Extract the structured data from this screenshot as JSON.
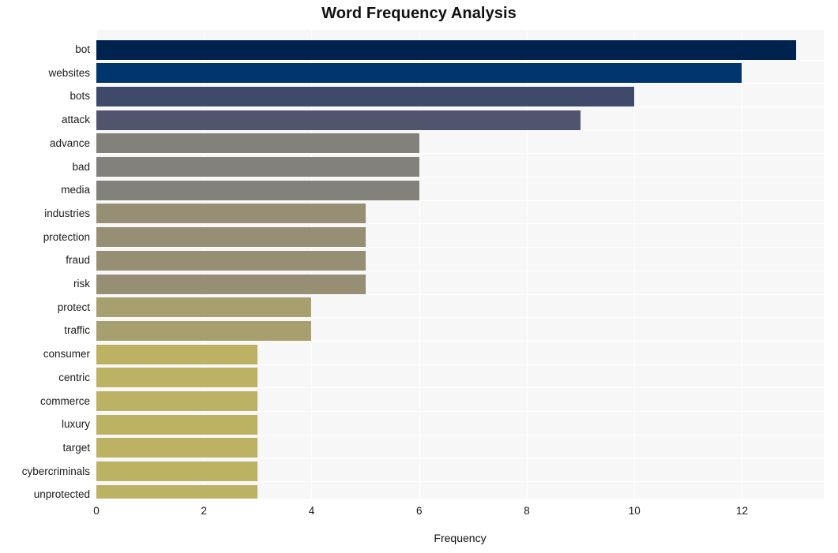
{
  "chart_data": {
    "type": "bar",
    "orientation": "horizontal",
    "title": "Word Frequency Analysis",
    "xlabel": "Frequency",
    "ylabel": "",
    "xlim": [
      0,
      13.52
    ],
    "xticks": [
      0,
      2,
      4,
      6,
      8,
      10,
      12
    ],
    "xticklabels": [
      "0",
      "2",
      "4",
      "6",
      "8",
      "10",
      "12"
    ],
    "grid": true,
    "legend": null,
    "categories": [
      "bot",
      "websites",
      "bots",
      "attack",
      "advance",
      "bad",
      "media",
      "industries",
      "protection",
      "fraud",
      "risk",
      "protect",
      "traffic",
      "consumer",
      "centric",
      "commerce",
      "luxury",
      "target",
      "cybercriminals",
      "unprotected"
    ],
    "values": [
      13,
      12,
      10,
      9,
      6,
      6,
      6,
      5,
      5,
      5,
      5,
      4,
      4,
      3,
      3,
      3,
      3,
      3,
      3,
      3
    ],
    "bar_colors": [
      "#00224e",
      "#00356e",
      "#3f4a6b",
      "#50546c",
      "#82817a",
      "#82817a",
      "#82817a",
      "#968f73",
      "#968f73",
      "#968f73",
      "#968f73",
      "#a89f6e",
      "#a89f6e",
      "#bdb164",
      "#bdb164",
      "#bdb164",
      "#bdb164",
      "#bdb164",
      "#bdb164",
      "#bdb164"
    ],
    "plot_background": "#f7f7f7",
    "gridline_color": "#ffffff",
    "figure_background": "#ffffff"
  }
}
